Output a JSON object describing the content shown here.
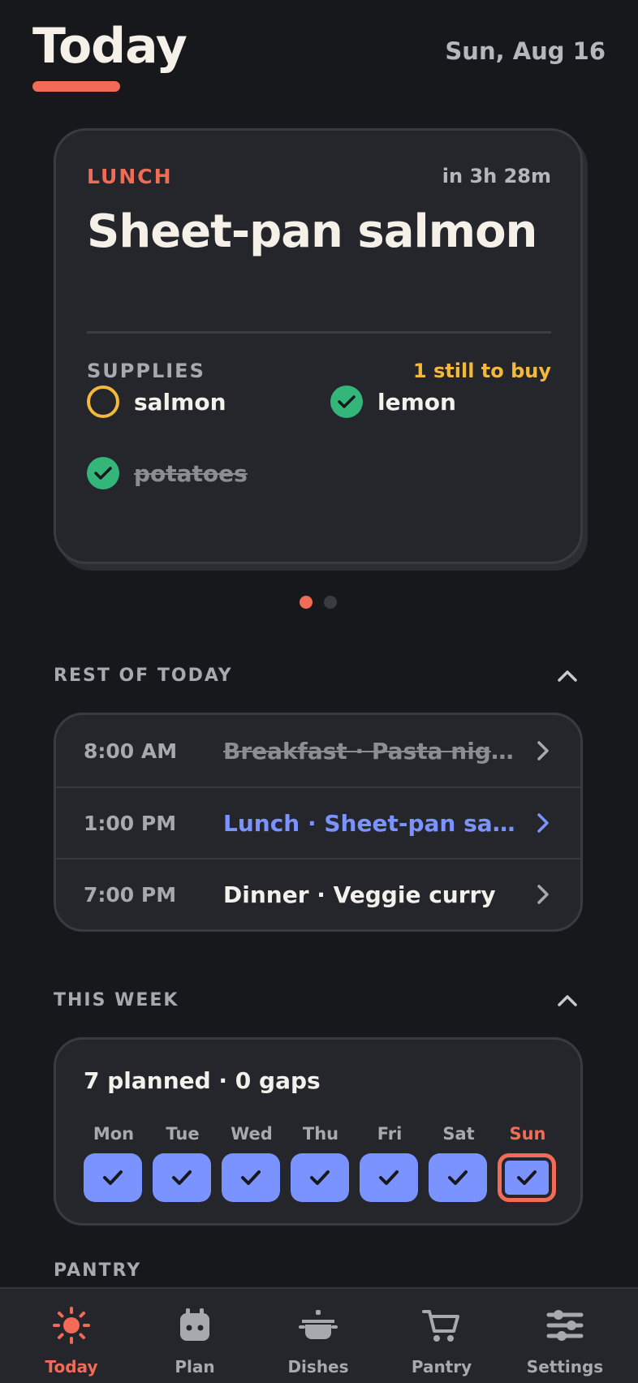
{
  "header": {
    "title": "Today",
    "date": "Sun, Aug 16"
  },
  "meal_card": {
    "label": "LUNCH",
    "eta": "in 3h 28m",
    "name": "Sheet-pan salmon",
    "supplies_label": "SUPPLIES",
    "supplies_status": "1 still to buy",
    "supplies": [
      {
        "name": "salmon",
        "state": "to-buy"
      },
      {
        "name": "lemon",
        "state": "have"
      },
      {
        "name": "potatoes",
        "state": "used"
      }
    ],
    "pager": {
      "pages": 2,
      "current": 1
    }
  },
  "rest_of_today": {
    "title": "REST OF TODAY",
    "rows": [
      {
        "time": "8:00 AM",
        "title": "Breakfast · Pasta night",
        "state": "done"
      },
      {
        "time": "1:00 PM",
        "title": "Lunch · Sheet-pan salmon",
        "state": "current"
      },
      {
        "time": "7:00 PM",
        "title": "Dinner · Veggie curry",
        "state": "upcoming"
      }
    ]
  },
  "this_week": {
    "title": "THIS WEEK",
    "summary": "7 planned · 0 gaps",
    "days": [
      {
        "label": "Mon",
        "planned": true
      },
      {
        "label": "Tue",
        "planned": true
      },
      {
        "label": "Wed",
        "planned": true
      },
      {
        "label": "Thu",
        "planned": true
      },
      {
        "label": "Fri",
        "planned": true
      },
      {
        "label": "Sat",
        "planned": true
      },
      {
        "label": "Sun",
        "planned": true,
        "today": true
      }
    ]
  },
  "pantry": {
    "title": "PANTRY"
  },
  "nav": {
    "items": [
      {
        "label": "Today",
        "icon": "sun-icon",
        "active": true
      },
      {
        "label": "Plan",
        "icon": "calendar-icon"
      },
      {
        "label": "Dishes",
        "icon": "pot-icon"
      },
      {
        "label": "Pantry",
        "icon": "cart-icon"
      },
      {
        "label": "Settings",
        "icon": "sliders-icon"
      }
    ]
  },
  "colors": {
    "background": "#17181c",
    "card": "#25262b",
    "accent": "#f26b57",
    "highlight": "#7a93ff",
    "warning": "#f4b93b",
    "success": "#34b57a"
  }
}
